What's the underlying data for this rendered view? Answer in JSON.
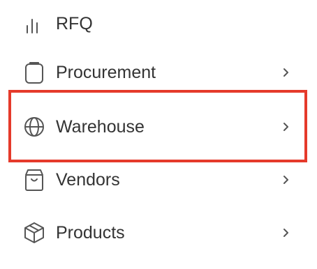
{
  "sidebar": {
    "items": [
      {
        "label": "RFQ",
        "icon": "bar-chart-icon",
        "has_chevron": false
      },
      {
        "label": "Procurement",
        "icon": "clipboard-icon",
        "has_chevron": true
      },
      {
        "label": "Warehouse",
        "icon": "globe-icon",
        "has_chevron": true,
        "highlighted": true
      },
      {
        "label": "Vendors",
        "icon": "shopping-bag-icon",
        "has_chevron": true
      },
      {
        "label": "Products",
        "icon": "package-box-icon",
        "has_chevron": true
      }
    ]
  },
  "colors": {
    "text": "#333333",
    "icon": "#555555",
    "highlight_border": "#e53a2b"
  }
}
